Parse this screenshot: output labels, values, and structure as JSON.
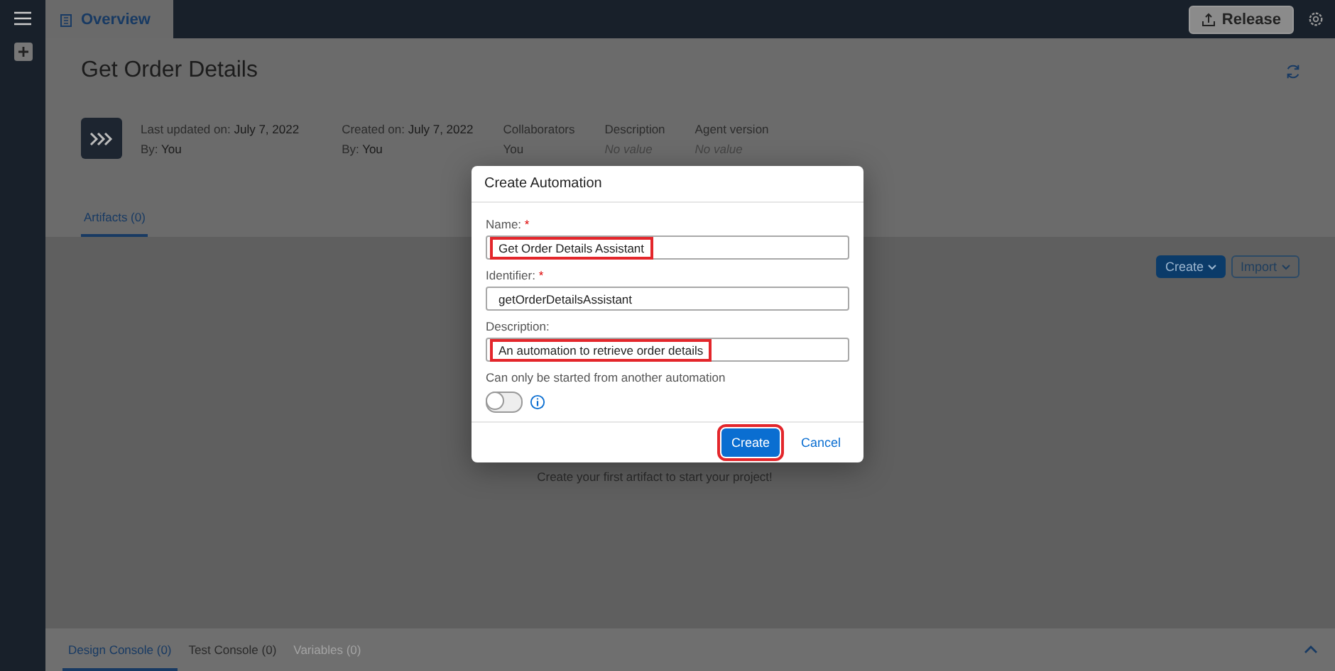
{
  "top_bar": {
    "tabs": [
      {
        "label": "Overview",
        "selected": true
      }
    ],
    "release_button": "Release"
  },
  "project": {
    "title": "Get Order Details",
    "meta": [
      {
        "label": "Last updated on:",
        "value": "July 7, 2022",
        "by_label": "By:",
        "by_value": "You"
      },
      {
        "label": "Created on:",
        "value": "July 7, 2022",
        "by_label": "By:",
        "by_value": "You"
      },
      {
        "label": "Collaborators",
        "value": "You",
        "kind": "plain"
      },
      {
        "label": "Description",
        "value": "No value",
        "kind": "empty"
      },
      {
        "label": "Agent version",
        "value": "No value",
        "kind": "empty"
      }
    ]
  },
  "artifact_tabs": [
    {
      "label": "Artifacts (0)",
      "selected": true
    }
  ],
  "artifact_actions": [
    {
      "label": "Create",
      "kind": "primary"
    },
    {
      "label": "Import",
      "kind": "secondary"
    }
  ],
  "empty_message": "Create your first artifact to start your project!",
  "dialog": {
    "title": "Create Automation",
    "fields": [
      {
        "label": "Name:",
        "required_mark": "*",
        "value": "Get Order Details Assistant",
        "highlighted": true
      },
      {
        "label": "Identifier:",
        "required_mark": "*",
        "value": "getOrderDetailsAssistant",
        "highlighted": false
      },
      {
        "label": "Description:",
        "value": "An automation to retrieve order details",
        "highlighted": true
      }
    ],
    "toggle": {
      "label": "Can only be started from another automation",
      "on": false
    },
    "buttons": [
      {
        "label": "Create",
        "kind": "primary",
        "highlighted": true
      },
      {
        "label": "Cancel",
        "kind": "link",
        "highlighted": false
      }
    ]
  },
  "console_tabs": [
    {
      "label": "Design Console (0)",
      "selected": true,
      "disabled": false
    },
    {
      "label": "Test Console (0)",
      "selected": false,
      "disabled": false
    },
    {
      "label": "Variables (0)",
      "selected": false,
      "disabled": true
    }
  ]
}
